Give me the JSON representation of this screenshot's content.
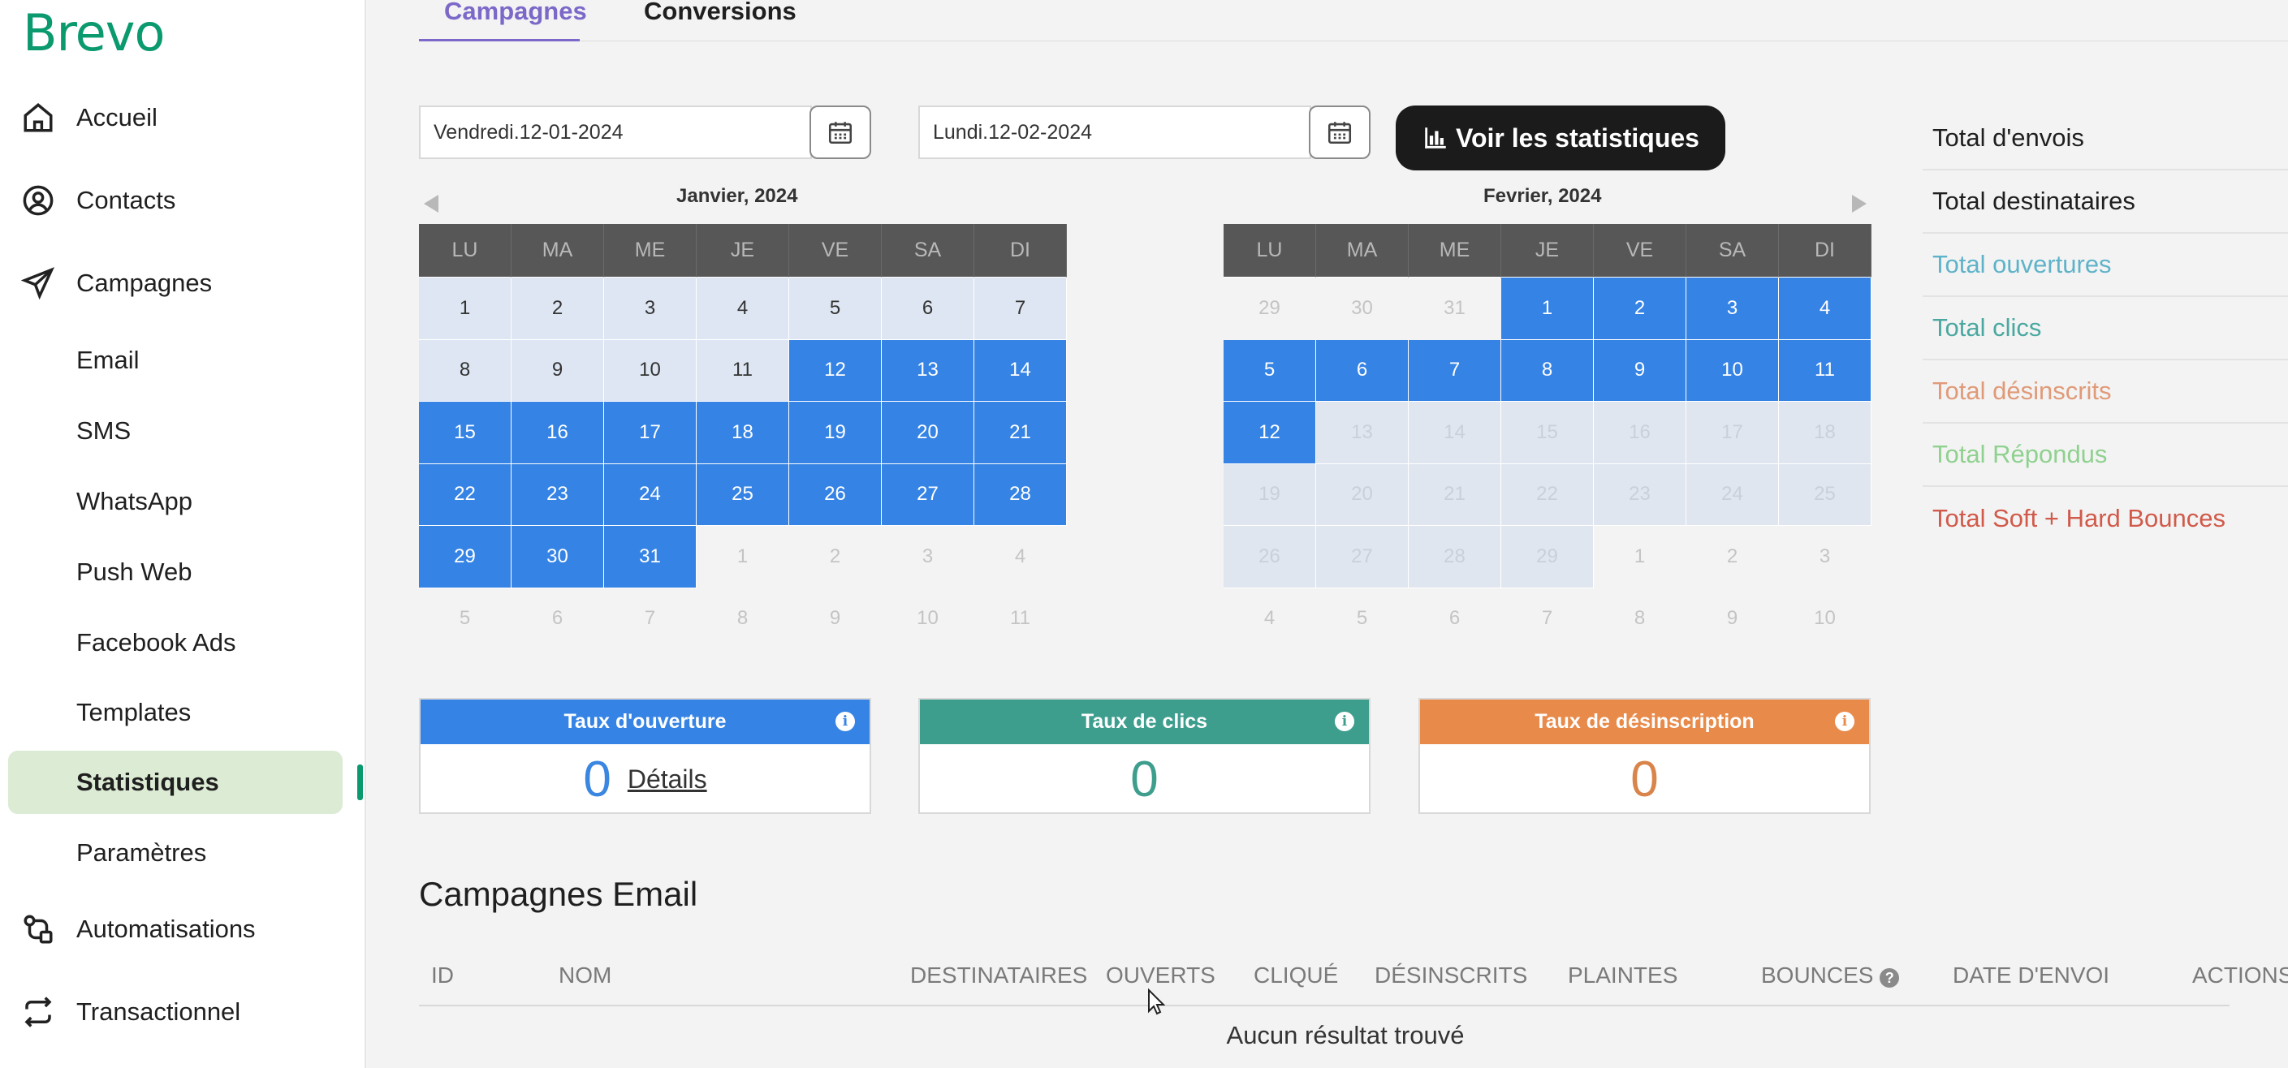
{
  "sidebar": {
    "logo": "Brevo",
    "items": [
      {
        "label": "Accueil",
        "icon": "home-icon"
      },
      {
        "label": "Contacts",
        "icon": "user-circle-icon"
      },
      {
        "label": "Campagnes",
        "icon": "paper-plane-icon"
      },
      {
        "label": "Email"
      },
      {
        "label": "SMS"
      },
      {
        "label": "WhatsApp"
      },
      {
        "label": "Push Web"
      },
      {
        "label": "Facebook Ads"
      },
      {
        "label": "Templates"
      },
      {
        "label": "Statistiques",
        "active": true
      },
      {
        "label": "Paramètres"
      },
      {
        "label": "Automatisations",
        "icon": "automation-icon"
      },
      {
        "label": "Transactionnel",
        "icon": "repeat-icon"
      }
    ]
  },
  "tabs": [
    {
      "label": "Campagnes",
      "active": true
    },
    {
      "label": "Conversions"
    }
  ],
  "date_range": {
    "start": "Vendredi.12-01-2024",
    "end": "Lundi.12-02-2024",
    "button": "Voir les statistiques"
  },
  "calendars": {
    "weekdays": [
      "LU",
      "MA",
      "ME",
      "JE",
      "VE",
      "SA",
      "DI"
    ],
    "january": {
      "title": "Janvier, 2024",
      "days": [
        "1",
        "2",
        "3",
        "4",
        "5",
        "6",
        "7",
        "8",
        "9",
        "10",
        "11",
        "12",
        "13",
        "14",
        "15",
        "16",
        "17",
        "18",
        "19",
        "20",
        "21",
        "22",
        "23",
        "24",
        "25",
        "26",
        "27",
        "28",
        "29",
        "30",
        "31",
        "1",
        "2",
        "3",
        "4",
        "5",
        "6",
        "7",
        "8",
        "9",
        "10",
        "11"
      ],
      "selected_from": "12",
      "selected_to": "31"
    },
    "february": {
      "title": "Fevrier, 2024",
      "days": [
        "29",
        "30",
        "31",
        "1",
        "2",
        "3",
        "4",
        "5",
        "6",
        "7",
        "8",
        "9",
        "10",
        "11",
        "12",
        "13",
        "14",
        "15",
        "16",
        "17",
        "18",
        "19",
        "20",
        "21",
        "22",
        "23",
        "24",
        "25",
        "26",
        "27",
        "28",
        "29",
        "1",
        "2",
        "3",
        "4",
        "5",
        "6",
        "7",
        "8",
        "9",
        "10"
      ],
      "selected_from": "1",
      "selected_to": "12"
    }
  },
  "totals": [
    {
      "label": "Total d'envois",
      "color": "#1f1f1f"
    },
    {
      "label": "Total destinataires",
      "color": "#1f1f1f"
    },
    {
      "label": "Total ouvertures",
      "color": "#5fb3c9"
    },
    {
      "label": "Total clics",
      "color": "#4aa8a0"
    },
    {
      "label": "Total désinscrits",
      "color": "#e09a78"
    },
    {
      "label": "Total Répondus",
      "color": "#8fd18f"
    },
    {
      "label": "Total Soft + Hard Bounces",
      "color": "#d15a4a"
    }
  ],
  "rates": [
    {
      "title": "Taux d'ouverture",
      "value": "0",
      "link": "Détails",
      "color": "#3583e4",
      "value_color": "#3a86e0"
    },
    {
      "title": "Taux de clics",
      "value": "0",
      "color": "#3e9e8e",
      "value_color": "#3e9e8e"
    },
    {
      "title": "Taux de désinscription",
      "value": "0",
      "color": "#e88a4a",
      "value_color": "#d9844a"
    }
  ],
  "email_campaigns": {
    "title": "Campagnes Email",
    "columns": [
      "ID",
      "NOM",
      "DESTINATAIRES",
      "OUVERTS",
      "CLIQUÉ",
      "DÉSINSCRITS",
      "PLAINTES",
      "BOUNCES",
      "DATE D'ENVOI",
      "ACTIONS"
    ],
    "empty": "Aucun résultat trouvé"
  }
}
